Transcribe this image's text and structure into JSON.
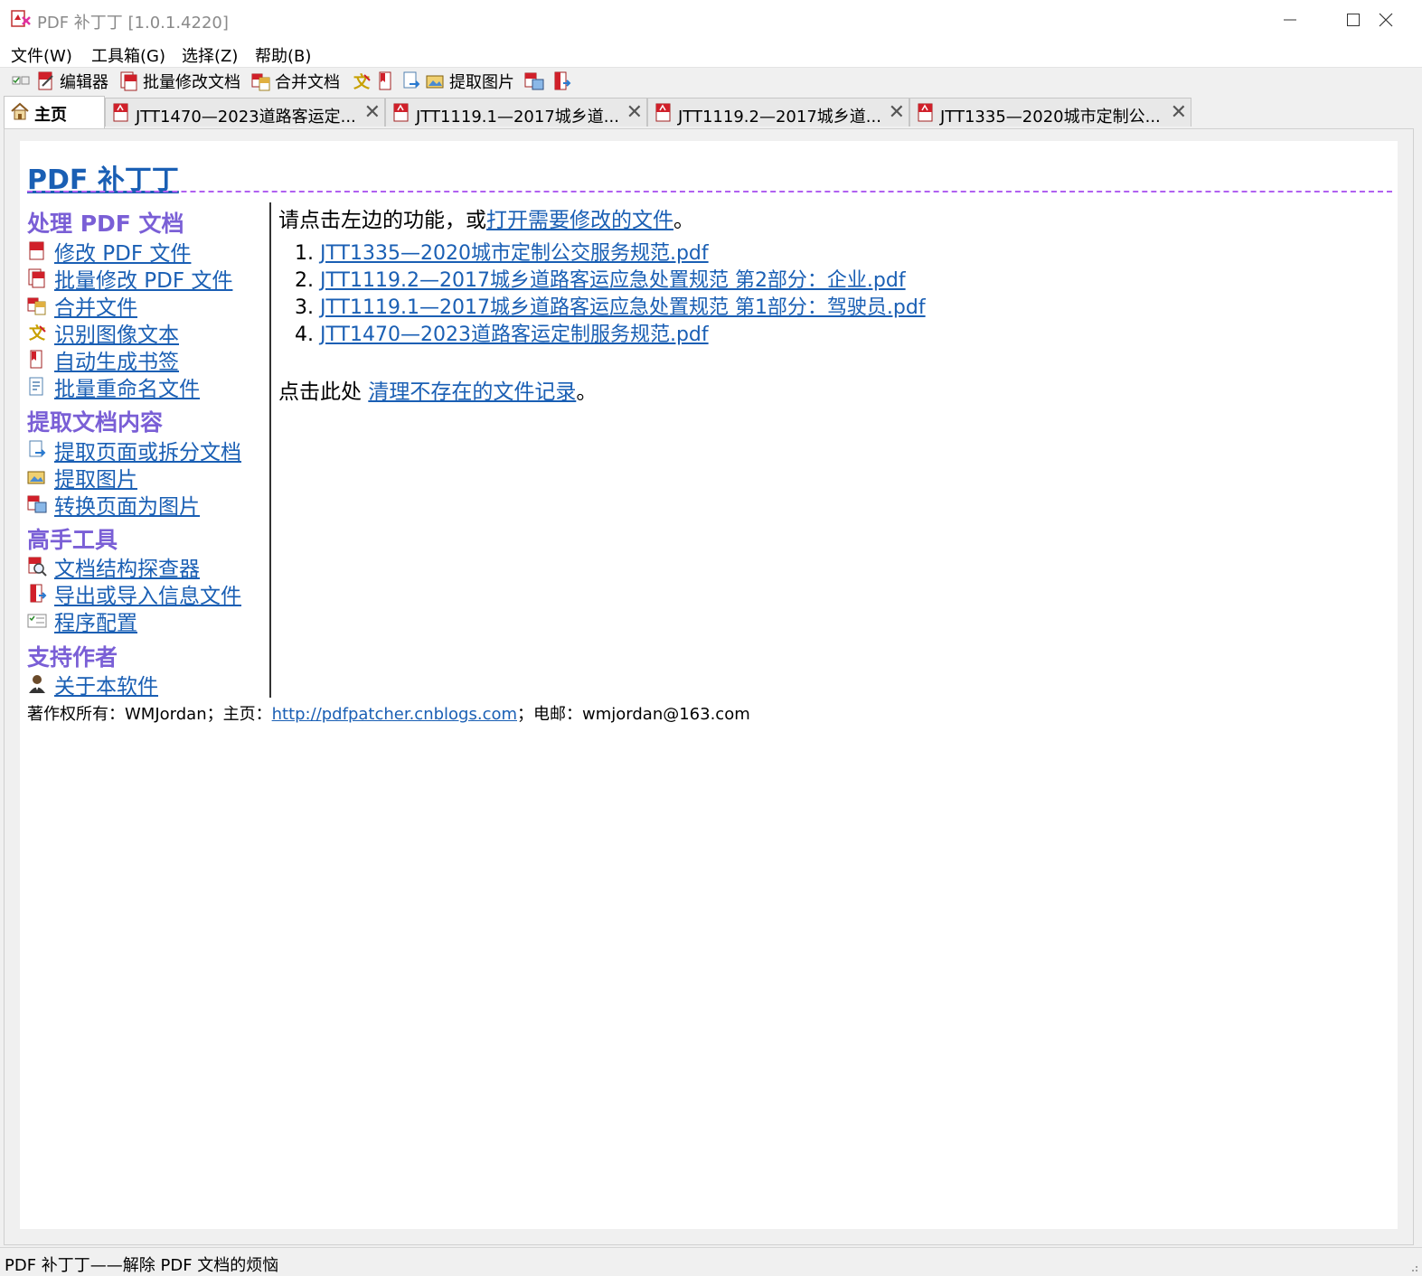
{
  "window": {
    "title": "PDF 补丁丁 [1.0.1.4220]",
    "icon": "app-logo-icon"
  },
  "menu": [
    "文件(W)",
    "工具箱(G)",
    "选择(Z)",
    "帮助(B)"
  ],
  "toolbar": {
    "editor_label": "编辑器",
    "batch_label": "批量修改文档",
    "merge_label": "合并文档",
    "extract_images_label": "提取图片"
  },
  "tabs": [
    {
      "label": "主页",
      "icon": "home-icon"
    },
    {
      "label": "JTT1470—2023道路客运定...",
      "icon": "pdf-icon"
    },
    {
      "label": "JTT1119.1—2017城乡道...",
      "icon": "pdf-icon"
    },
    {
      "label": "JTT1119.2—2017城乡道...",
      "icon": "pdf-icon"
    },
    {
      "label": "JTT1335—2020城市定制公...",
      "icon": "pdf-icon"
    }
  ],
  "home": {
    "title": "PDF 补丁丁",
    "sections": {
      "process": "处理 PDF 文档",
      "extract": "提取文档内容",
      "advanced": "高手工具",
      "support": "支持作者"
    },
    "links": {
      "modify": "修改 PDF 文件",
      "batch_modify": "批量修改 PDF 文件",
      "merge": "合并文件",
      "ocr": "识别图像文本",
      "bookmark": "自动生成书签",
      "rename": "批量重命名文件",
      "extract_pages": "提取页面或拆分文档",
      "extract_images": "提取图片",
      "convert_pages": "转换页面为图片",
      "inspector": "文档结构探查器",
      "info_file": "导出或导入信息文件",
      "config": "程序配置",
      "about": "关于本软件"
    },
    "intro_prefix": "请点击左边的功能，或",
    "intro_link": "打开需要修改的文件",
    "intro_suffix": "。",
    "recent_files": [
      {
        "num": "1.",
        "name": "JTT1335—2020城市定制公交服务规范.pdf"
      },
      {
        "num": "2.",
        "name": "JTT1119.2—2017城乡道路客运应急处置规范 第2部分：企业.pdf"
      },
      {
        "num": "3.",
        "name": "JTT1119.1—2017城乡道路客运应急处置规范 第1部分：驾驶员.pdf"
      },
      {
        "num": "4.",
        "name": "JTT1470—2023道路客运定制服务规范.pdf"
      }
    ],
    "cleanup_prefix": "点击此处 ",
    "cleanup_link": "清理不存在的文件记录",
    "cleanup_suffix": "。",
    "footer_prefix": "著作权所有：WMJordan；主页：",
    "footer_link": "http://pdfpatcher.cnblogs.com",
    "footer_suffix": "；电邮：wmjordan@163.com"
  },
  "status": "PDF 补丁丁——解除 PDF 文档的烦恼",
  "colors": {
    "link": "#1a5fb4",
    "section_heading": "#7a5fd6",
    "divider": "#b060f0",
    "pdf_red": "#d0202a"
  }
}
